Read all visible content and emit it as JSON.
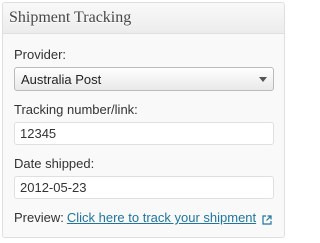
{
  "metabox": {
    "title": "Shipment Tracking"
  },
  "provider": {
    "label": "Provider:",
    "selected": "Australia Post"
  },
  "tracking": {
    "label": "Tracking number/link:",
    "value": "12345"
  },
  "date_shipped": {
    "label": "Date shipped:",
    "value": "2012-05-23"
  },
  "preview": {
    "label": "Preview:",
    "link_text": "Click here to track your shipment"
  },
  "icons": {
    "dropdown": "chevron-down-icon",
    "external": "external-link-icon"
  },
  "colors": {
    "link": "#21759b",
    "text": "#333333",
    "border": "#dfdfdf"
  }
}
